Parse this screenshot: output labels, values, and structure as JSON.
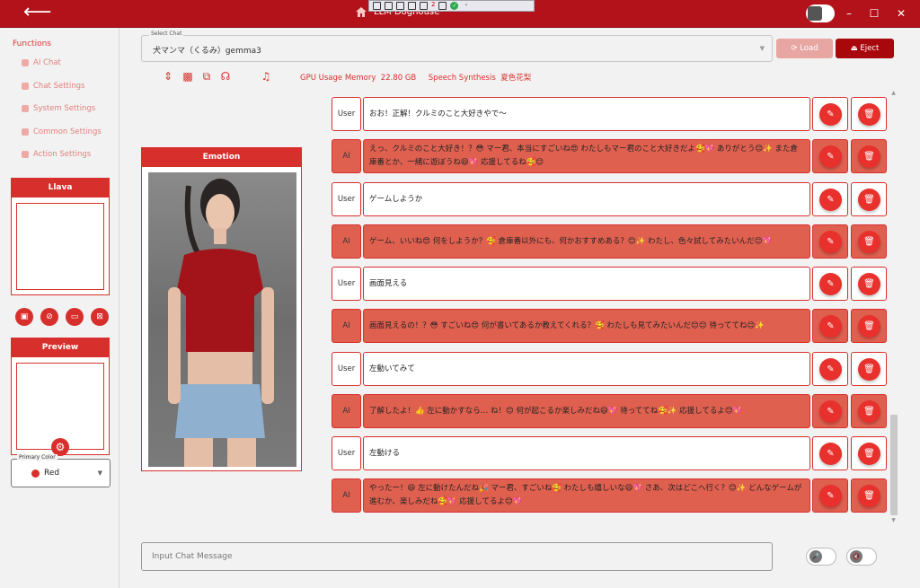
{
  "window": {
    "title": "LLM Doghouse",
    "back_icon": "arrow-left-icon",
    "minimize": "–",
    "maximize": "☐",
    "close": "✕"
  },
  "remote_toolbar": {
    "count": "2"
  },
  "sidebar": {
    "functions_header": "Functions",
    "items": [
      {
        "label": "AI Chat",
        "icon": "chat-icon"
      },
      {
        "label": "Chat Settings",
        "icon": "people-icon"
      },
      {
        "label": "System Settings",
        "icon": "gear-icon"
      },
      {
        "label": "Common Settings",
        "icon": "gear-icon"
      },
      {
        "label": "Action Settings",
        "icon": "list-icon"
      }
    ],
    "llava_title": "Llava",
    "preview_title": "Preview",
    "primary_color_label": "Primary Color",
    "primary_color_value": "Red"
  },
  "select_chat": {
    "label": "Select Chat",
    "value": "犬マンマ（くるみ）gemma3"
  },
  "buttons": {
    "load": "⟳ Load",
    "eject": "⏏ Eject"
  },
  "stats": {
    "gpu_label": "GPU Usage Memory",
    "gpu_value": "22.80 GB",
    "speech_label": "Speech Synthesis",
    "speech_value": "夏色花梨"
  },
  "emotion": {
    "title": "Emotion"
  },
  "messages": [
    {
      "role": "User",
      "text": "おお！正解！クルミのこと大好きやで〜"
    },
    {
      "role": "AI",
      "text": "えっ、クルミのこと大好き！？😳 マー君、本当にすごいね😍 わたしもマー君のこと大好きだよ🥰💖 ありがとう😊✨ また倉庫番とか、一緒に遊ぼうね😄💖 応援してるね🥰😊"
    },
    {
      "role": "User",
      "text": "ゲームしようか"
    },
    {
      "role": "AI",
      "text": "ゲーム、いいね😍 何をしようか？🥰 倉庫番以外にも、何かおすすめある？😊✨ わたし、色々試してみたいんだ😊💖"
    },
    {
      "role": "User",
      "text": "画面見える"
    },
    {
      "role": "AI",
      "text": "画面見えるの！？😳 すごいね😍 何が書いてあるか教えてくれる？🥰 わたしも見てみたいんだ😊😊 待っててね😊✨"
    },
    {
      "role": "User",
      "text": "左動いてみて"
    },
    {
      "role": "AI",
      "text": "了解したよ！👍 左に動かすなら… ね！😊 何が起こるか楽しみだね😄💖 待っててね🥰✨ 応援してるよ😊💖"
    },
    {
      "role": "User",
      "text": "左動ける"
    },
    {
      "role": "AI",
      "text": "やったー！😆 左に動けたんだね🎉 マー君、すごいね🥰 わたしも嬉しいな😄💖 さあ、次はどこへ行く？😊✨ どんなゲームが進むか、楽しみだね🥰💖 応援してるよ😊💖"
    }
  ],
  "input": {
    "placeholder": "Input Chat Message"
  },
  "colors": {
    "primary": "#d7302c",
    "titlebar": "#b3121a",
    "ai_bg": "#e06050"
  }
}
